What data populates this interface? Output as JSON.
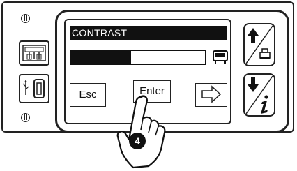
{
  "screen": {
    "title": "CONTRAST",
    "contrast_level": 0.45,
    "buttons": {
      "esc_label": "Esc",
      "enter_label": "Enter"
    }
  },
  "callout": {
    "step_number": "4"
  },
  "icons": {
    "display_icon": "monitor-icon",
    "up_key": "arrow-up-printer-icon",
    "down_key": "arrow-down-info-icon",
    "next_key": "arrow-right-icon"
  },
  "colors": {
    "ink": "#111111",
    "background": "#ffffff"
  }
}
